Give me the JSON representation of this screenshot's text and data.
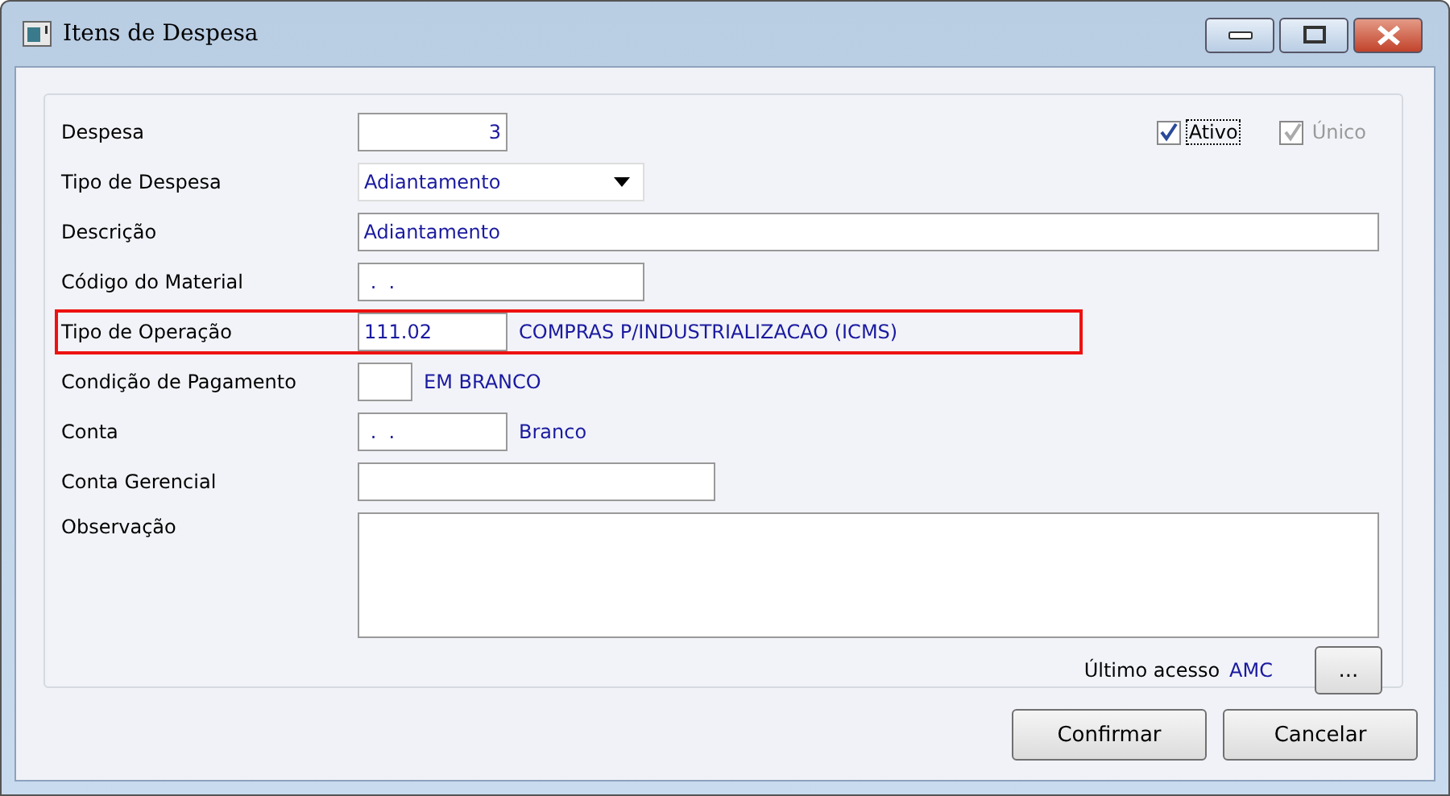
{
  "window": {
    "title": "Itens de Despesa"
  },
  "checkboxes": [
    {
      "label": "Ativo",
      "checked": true,
      "disabled": false,
      "focused": true
    },
    {
      "label": "Único",
      "checked": true,
      "disabled": true,
      "focused": false
    }
  ],
  "fields": [
    {
      "label": "Despesa",
      "kind": "number",
      "value": "3",
      "highlighted": false
    },
    {
      "label": "Tipo de Despesa",
      "kind": "dropdown",
      "value": "Adiantamento",
      "highlighted": false
    },
    {
      "label": "Descrição",
      "kind": "wide",
      "value": "Adiantamento",
      "highlighted": false
    },
    {
      "label": "Código do Material",
      "kind": "medium",
      "value": " .  .",
      "highlighted": false
    },
    {
      "label": "Tipo de Operação",
      "kind": "code",
      "value": "111.02",
      "description": "COMPRAS P/INDUSTRIALIZACAO (ICMS)",
      "highlighted": true
    },
    {
      "label": "Condição de Pagamento",
      "kind": "short",
      "description": "EM BRANCO",
      "highlighted": false
    },
    {
      "label": "Conta",
      "kind": "code",
      "value": " .  .",
      "description": "Branco",
      "highlighted": false
    },
    {
      "label": "Conta Gerencial",
      "kind": "long",
      "highlighted": false
    },
    {
      "label": "Observação",
      "kind": "textarea",
      "highlighted": false
    }
  ],
  "last_access": {
    "label": "Último acesso",
    "value": "AMC",
    "button": "..."
  },
  "buttons": [
    "Confirmar",
    "Cancelar"
  ]
}
